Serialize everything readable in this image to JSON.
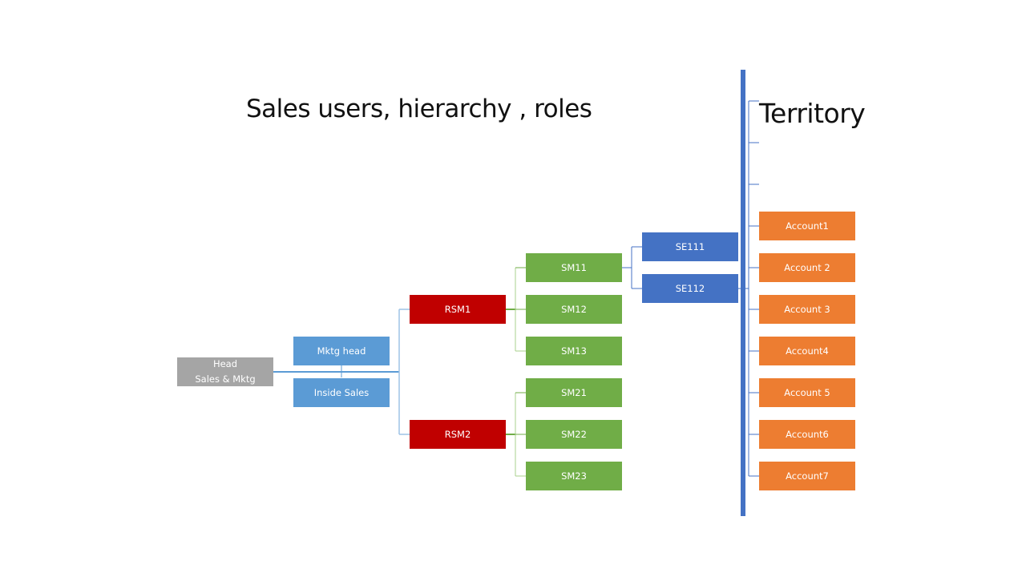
{
  "titles": {
    "main": "Sales users, hierarchy , roles",
    "territory": "Territory"
  },
  "colors": {
    "head": "#a5a5a5",
    "marketing": "#5b9bd5",
    "rsm": "#c00000",
    "sm": "#70ad47",
    "se": "#4472c4",
    "account": "#ed7d31",
    "territory_bar": "#4472c4"
  },
  "hierarchy": {
    "head": {
      "line1": "Head",
      "line2": "Sales & Mktg"
    },
    "marketing": [
      {
        "label": "Mktg head"
      },
      {
        "label": "Inside Sales"
      }
    ],
    "rsm": [
      {
        "label": "RSM1",
        "sms": [
          "SM11",
          "SM12",
          "SM13"
        ]
      },
      {
        "label": "RSM2",
        "sms": [
          "SM21",
          "SM22",
          "SM23"
        ]
      }
    ],
    "sm": [
      {
        "label": "SM11"
      },
      {
        "label": "SM12"
      },
      {
        "label": "SM13"
      },
      {
        "label": "SM21"
      },
      {
        "label": "SM22"
      },
      {
        "label": "SM23"
      }
    ],
    "se": [
      {
        "label": "SE111"
      },
      {
        "label": "SE112"
      }
    ]
  },
  "territory": {
    "accounts": [
      {
        "label": "Account1"
      },
      {
        "label": "Account 2"
      },
      {
        "label": "Account 3"
      },
      {
        "label": "Account4"
      },
      {
        "label": "Account 5"
      },
      {
        "label": "Account6"
      },
      {
        "label": "Account7"
      }
    ]
  }
}
